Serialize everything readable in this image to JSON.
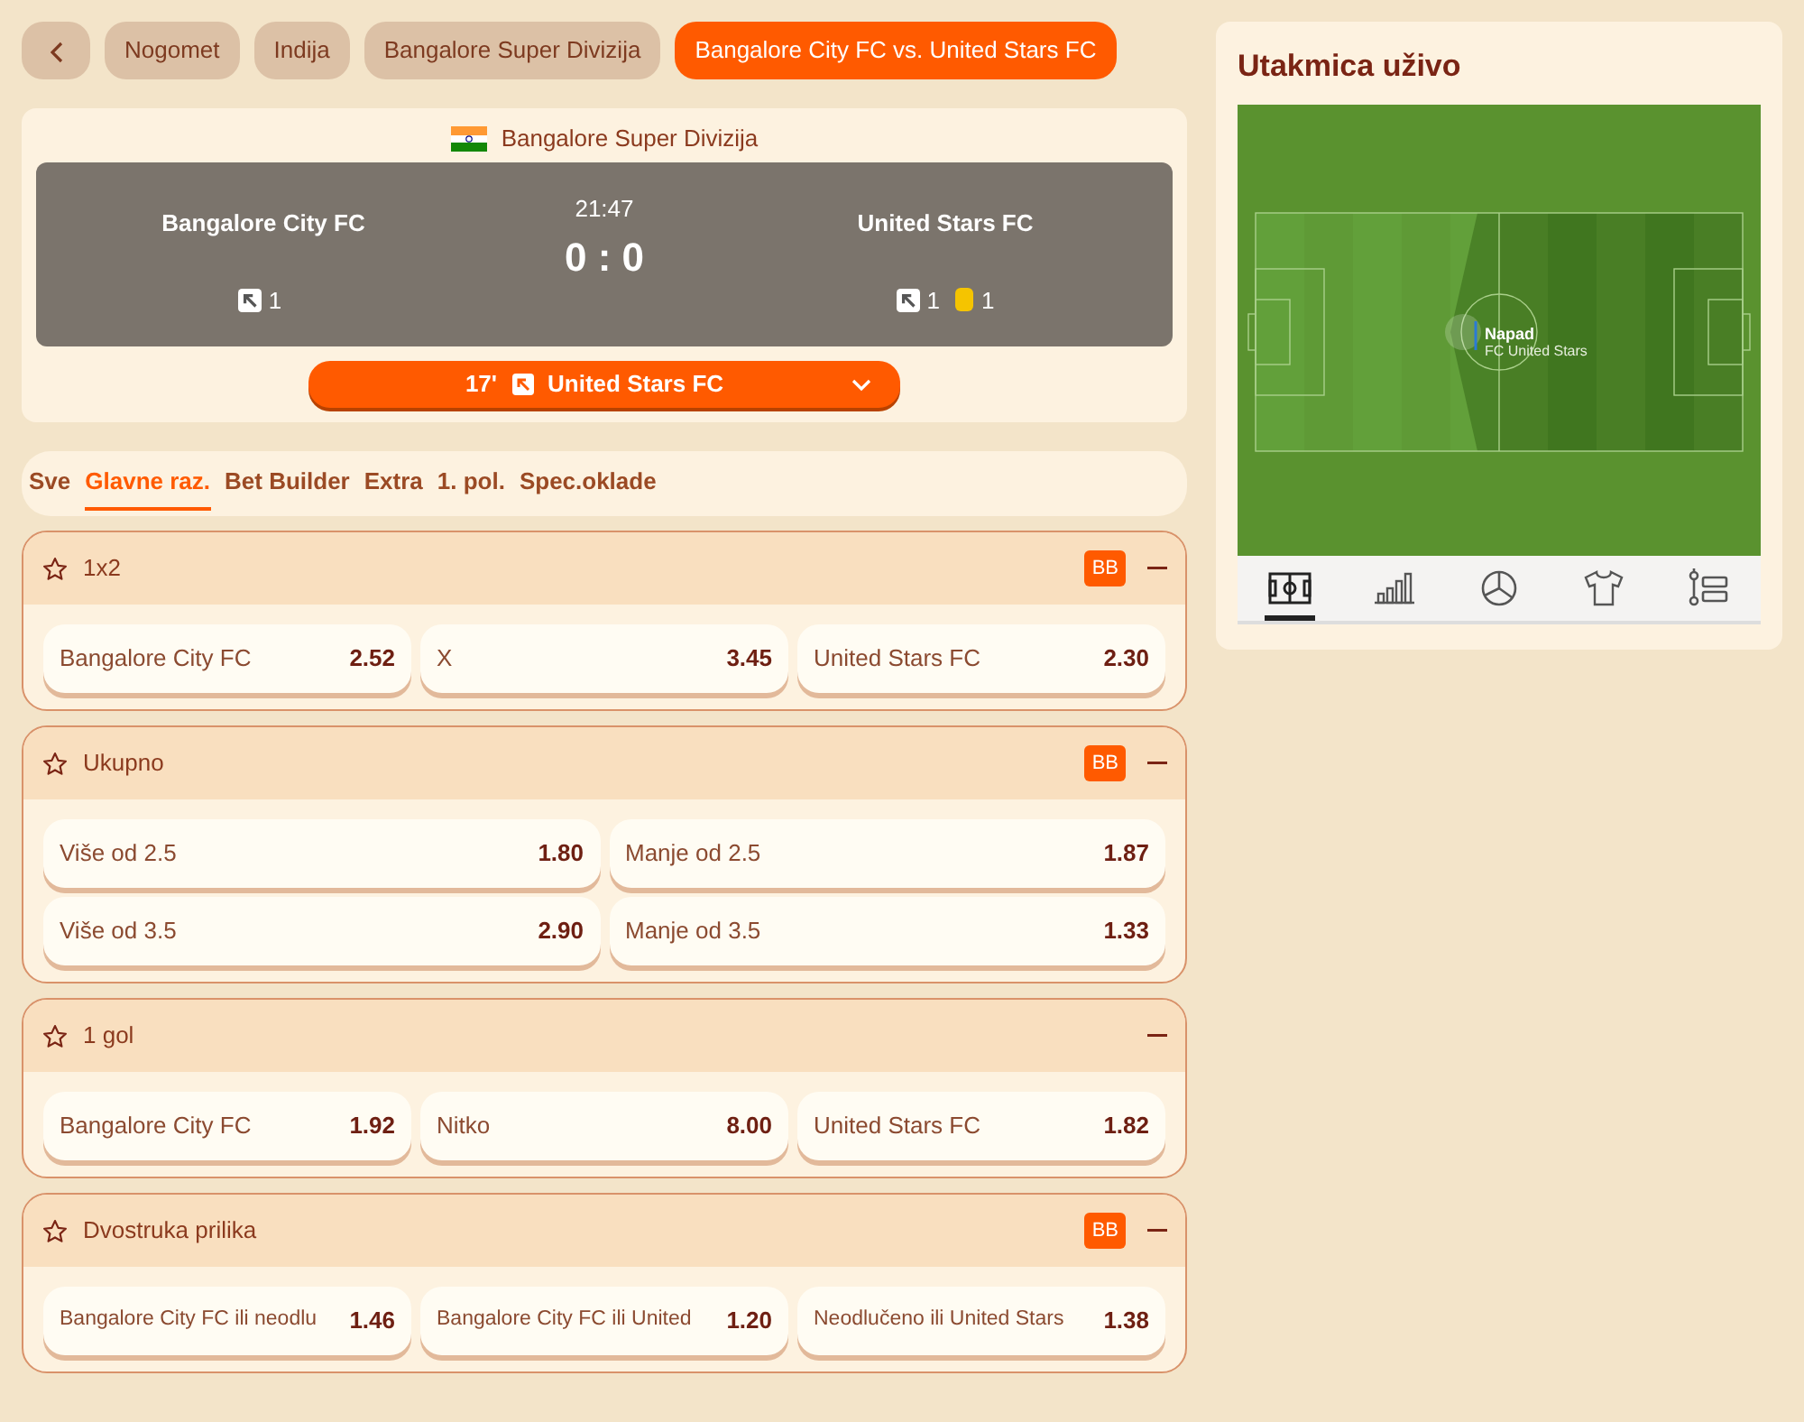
{
  "breadcrumbs": [
    {
      "kind": "back",
      "selected": false
    },
    {
      "kind": "link",
      "label": "Nogomet",
      "selected": false
    },
    {
      "kind": "link",
      "label": "Indija",
      "selected": false
    },
    {
      "kind": "link",
      "label": "Bangalore Super Divizija",
      "selected": false
    },
    {
      "kind": "link",
      "label": "Bangalore City FC vs. United Stars FC",
      "selected": true
    }
  ],
  "match": {
    "league": "Bangalore Super Divizija",
    "time": "21:47",
    "score": "0 : 0",
    "home": {
      "name": "Bangalore City FC",
      "corners": "1"
    },
    "away": {
      "name": "United Stars FC",
      "corners": "1",
      "yellow_cards": "1"
    },
    "last_event": {
      "minute": "17'",
      "team": "United Stars FC"
    }
  },
  "tabs": [
    {
      "label": "Sve",
      "selected": false
    },
    {
      "label": "Glavne raz.",
      "selected": true
    },
    {
      "label": "Bet Builder",
      "selected": false
    },
    {
      "label": "Extra",
      "selected": false
    },
    {
      "label": "1. pol.",
      "selected": false
    },
    {
      "label": "Spec.oklade",
      "selected": false
    }
  ],
  "markets": [
    {
      "title": "1x2",
      "badge": "BB",
      "selections": [
        {
          "label": "Bangalore City FC",
          "odds": "2.52"
        },
        {
          "label": "X",
          "odds": "3.45"
        },
        {
          "label": "United Stars FC",
          "odds": "2.30"
        }
      ]
    },
    {
      "title": "Ukupno",
      "badge": "BB",
      "selections": [
        {
          "label": "Više od 2.5",
          "odds": "1.80"
        },
        {
          "label": "Manje od 2.5",
          "odds": "1.87"
        },
        {
          "label": "Više od 3.5",
          "odds": "2.90"
        },
        {
          "label": "Manje od 3.5",
          "odds": "1.33"
        }
      ]
    },
    {
      "title": "1 gol",
      "selections": [
        {
          "label": "Bangalore City FC",
          "odds": "1.92"
        },
        {
          "label": "Nitko",
          "odds": "8.00"
        },
        {
          "label": "United Stars FC",
          "odds": "1.82"
        }
      ]
    },
    {
      "title": "Dvostruka prilika",
      "badge": "BB",
      "selections": [
        {
          "label": "Bangalore City FC ili neodlu",
          "odds": "1.46"
        },
        {
          "label": "Bangalore City FC ili United",
          "odds": "1.20"
        },
        {
          "label": "Neodlučeno ili United Stars",
          "odds": "1.38"
        }
      ]
    }
  ],
  "live": {
    "title": "Utakmica uživo",
    "event_title": "Napad",
    "event_team": "FC United Stars",
    "tabs": [
      {
        "kind": "pitch",
        "selected": true
      },
      {
        "kind": "bars",
        "selected": false
      },
      {
        "kind": "pie",
        "selected": false
      },
      {
        "kind": "shirt",
        "selected": false
      },
      {
        "kind": "timeline",
        "selected": false
      }
    ]
  }
}
